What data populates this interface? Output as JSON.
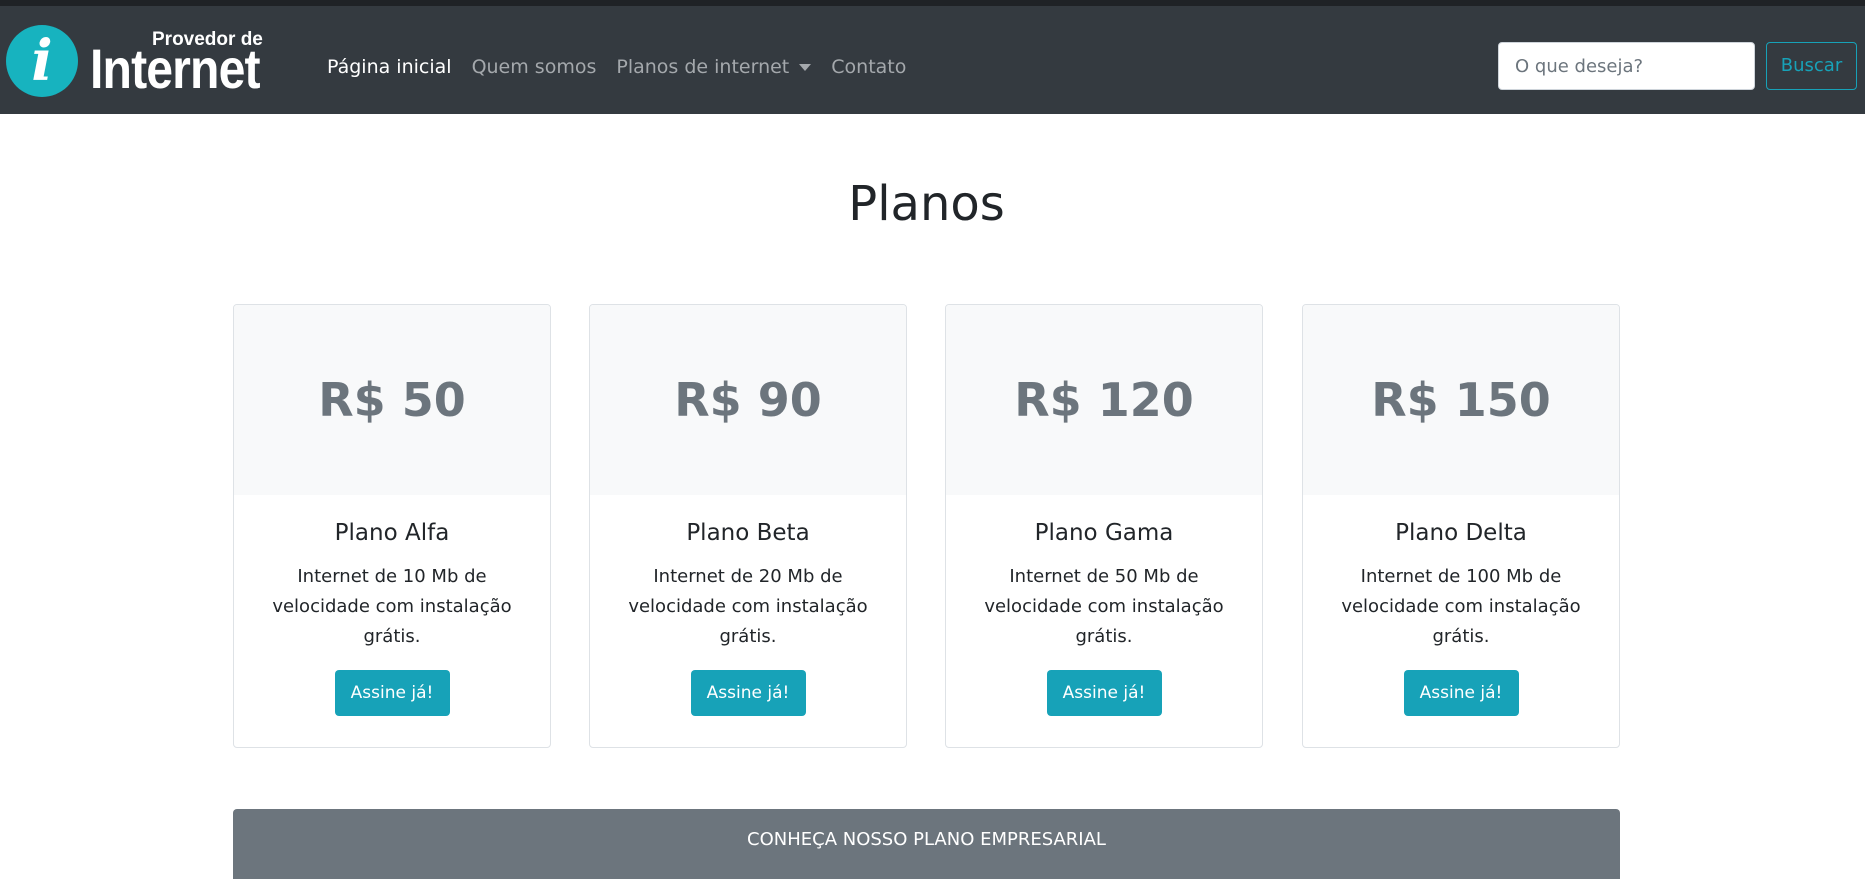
{
  "brand": {
    "logo_letter": "i",
    "line1": "Provedor de",
    "line2": "Internet",
    "circle_color": "#17b3bf"
  },
  "nav": {
    "items": [
      {
        "label": "Página inicial",
        "active": true
      },
      {
        "label": "Quem somos",
        "active": false
      },
      {
        "label": "Planos de internet",
        "active": false,
        "dropdown": true
      },
      {
        "label": "Contato",
        "active": false
      }
    ]
  },
  "search": {
    "placeholder": "O que deseja?",
    "value": "",
    "button_label": "Buscar"
  },
  "main": {
    "title": "Planos",
    "plans": [
      {
        "price": "R$ 50",
        "name": "Plano Alfa",
        "description": "Internet de 10 Mb de velocidade com instalação grátis.",
        "button_label": "Assine já!"
      },
      {
        "price": "R$ 90",
        "name": "Plano Beta",
        "description": "Internet de 20 Mb de velocidade com instalação grátis.",
        "button_label": "Assine já!"
      },
      {
        "price": "R$ 120",
        "name": "Plano Gama",
        "description": "Internet de 50 Mb de velocidade com instalação grátis.",
        "button_label": "Assine já!"
      },
      {
        "price": "R$ 150",
        "name": "Plano Delta",
        "description": "Internet de 100 Mb de velocidade com instalação grátis.",
        "button_label": "Assine já!"
      }
    ],
    "enterprise_banner": "CONHEÇA NOSSO PLANO EMPRESARIAL"
  },
  "colors": {
    "navbar": "#343a40",
    "accent": "#17a2b8",
    "price_text": "#6c757d",
    "card_head": "#f8f9fa",
    "banner": "#6c757d"
  }
}
